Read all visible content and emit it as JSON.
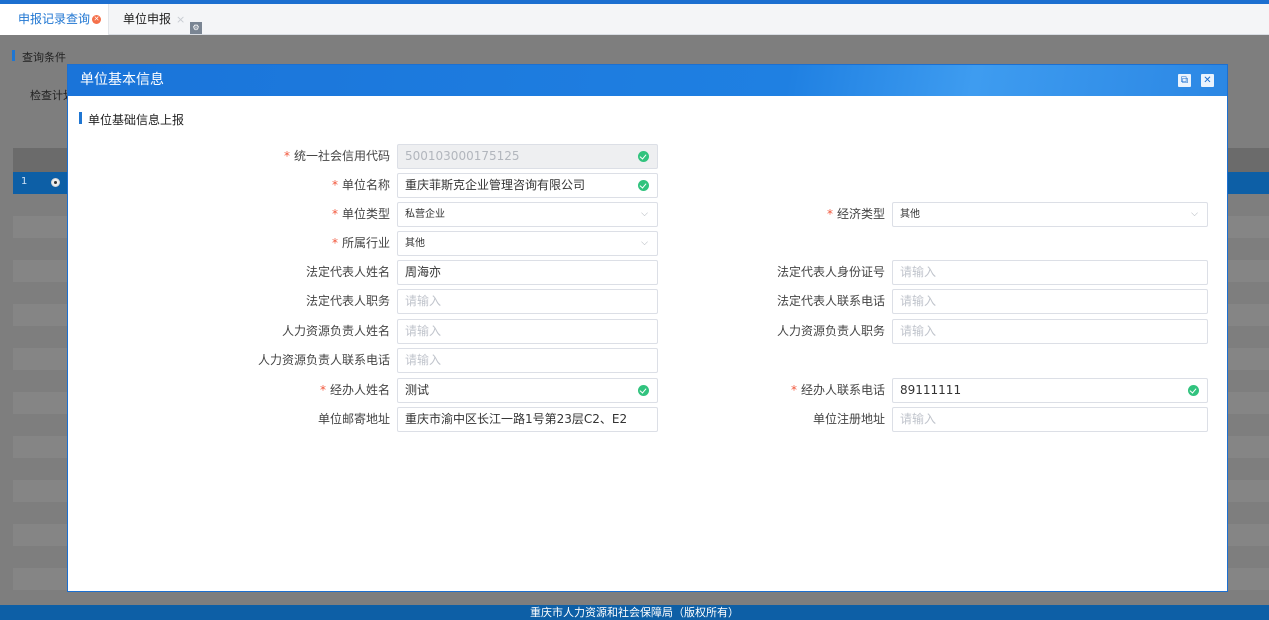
{
  "tabs": [
    {
      "label": "申报记录查询"
    },
    {
      "label": "单位申报"
    }
  ],
  "background": {
    "query_title": "查询条件",
    "check_label": "检查计划",
    "selected_row_index": "1"
  },
  "modal": {
    "title": "单位基本信息",
    "section_title": "单位基础信息上报"
  },
  "form": {
    "credit_code": {
      "label": "统一社会信用代码",
      "value": "500103000175125",
      "required": true
    },
    "unit_name": {
      "label": "单位名称",
      "value": "重庆菲斯克企业管理咨询有限公司",
      "required": true
    },
    "unit_type": {
      "label": "单位类型",
      "value": "私营企业",
      "required": true
    },
    "economy_type": {
      "label": "经济类型",
      "value": "其他",
      "required": true
    },
    "industry": {
      "label": "所属行业",
      "value": "其他",
      "required": true
    },
    "legal_rep_name": {
      "label": "法定代表人姓名",
      "value": "周海亦"
    },
    "legal_rep_id": {
      "label": "法定代表人身份证号",
      "placeholder": "请输入"
    },
    "legal_rep_title": {
      "label": "法定代表人职务",
      "placeholder": "请输入"
    },
    "legal_rep_phone": {
      "label": "法定代表人联系电话",
      "placeholder": "请输入"
    },
    "hr_name": {
      "label": "人力资源负责人姓名",
      "placeholder": "请输入"
    },
    "hr_title": {
      "label": "人力资源负责人职务",
      "placeholder": "请输入"
    },
    "hr_phone": {
      "label": "人力资源负责人联系电话",
      "placeholder": "请输入"
    },
    "agent_name": {
      "label": "经办人姓名",
      "value": "测试",
      "required": true
    },
    "agent_phone": {
      "label": "经办人联系电话",
      "value": "89111111",
      "required": true
    },
    "mail_address": {
      "label": "单位邮寄地址",
      "value": "重庆市渝中区长江一路1号第23层C2、E2"
    },
    "reg_address": {
      "label": "单位注册地址",
      "placeholder": "请输入"
    }
  },
  "footer": {
    "text": "重庆市人力资源和社会保障局（版权所有）"
  },
  "colors": {
    "accent": "#1c6fd0",
    "required": "#f2563b",
    "valid": "#31c37e"
  }
}
